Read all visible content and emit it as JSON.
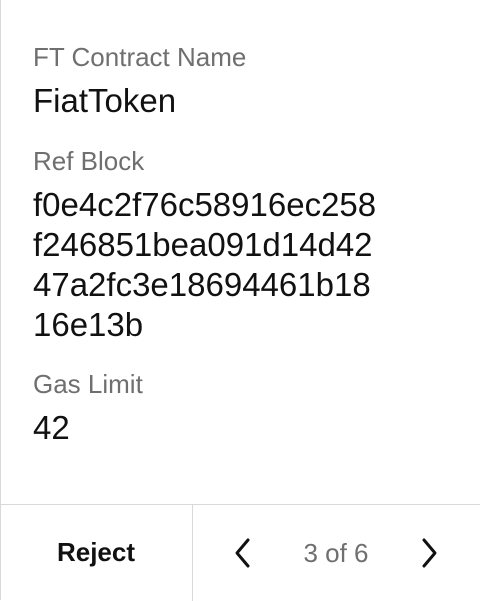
{
  "fields": {
    "contract_name": {
      "label": "FT Contract Name",
      "value": "FiatToken"
    },
    "ref_block": {
      "label": "Ref Block",
      "lines": [
        "f0e4c2f76c58916ec258",
        "f246851bea091d14d42",
        "47a2fc3e18694461b18",
        "16e13b"
      ]
    },
    "gas_limit": {
      "label": "Gas Limit",
      "value": "42"
    }
  },
  "footer": {
    "reject_label": "Reject",
    "pager": {
      "prev_icon": "chevron-left-icon",
      "next_icon": "chevron-right-icon",
      "indicator": "3 of 6"
    }
  }
}
